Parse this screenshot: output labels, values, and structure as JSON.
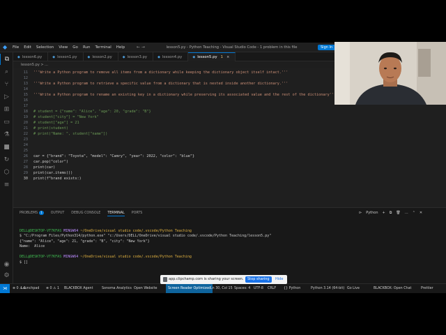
{
  "titlebar": {
    "menu": [
      "File",
      "Edit",
      "Selection",
      "View",
      "Go",
      "Run",
      "Terminal",
      "Help"
    ],
    "window_title": "lesson5.py - Python Teaching - Visual Studio Code - 1 problem in this file",
    "signin_label": "Sign In"
  },
  "tabs": [
    {
      "label": "lesson6.py",
      "active": false
    },
    {
      "label": "lesson1.py",
      "active": false
    },
    {
      "label": "lesson2.py",
      "active": false
    },
    {
      "label": "lesson3.py",
      "active": false
    },
    {
      "label": "lesson4.py",
      "active": false
    },
    {
      "label": "lesson5.py",
      "active": true,
      "modified": "1"
    }
  ],
  "breadcrumb": "lesson5.py > ...",
  "editor": {
    "lines": [
      {
        "n": "11",
        "text": "'''Write a Python program to remove all items from a dictionary while keeping the dictionary object itself intact.'''",
        "kind": "str"
      },
      {
        "n": "12",
        "text": "",
        "kind": "pl"
      },
      {
        "n": "13",
        "text": "'''Write a Python program to retrieve a specific value from a dictionary that is nested inside another dictionary.'''",
        "kind": "str"
      },
      {
        "n": "14",
        "text": "",
        "kind": "pl"
      },
      {
        "n": "15",
        "text": "'''Write a Python program to rename an existing key in a dictionary while preserving its associated value and the rest of the dictionary'''",
        "kind": "str"
      },
      {
        "n": "16",
        "text": "",
        "kind": "pl"
      },
      {
        "n": "17",
        "text": "",
        "kind": "pl"
      },
      {
        "n": "18",
        "text": "# student = {\"name\": \"Alice\", \"age\": 20, \"grade\": \"B\"}",
        "kind": "cmt"
      },
      {
        "n": "19",
        "text": "# student[\"city\"] = \"New York\"",
        "kind": "cmt"
      },
      {
        "n": "20",
        "text": "# student[\"age\"] = 21",
        "kind": "cmt"
      },
      {
        "n": "21",
        "text": "# print(student)",
        "kind": "cmt"
      },
      {
        "n": "22",
        "text": "# print(\"Name: \", student[\"name\"])",
        "kind": "cmt"
      },
      {
        "n": "23",
        "text": "",
        "kind": "pl"
      },
      {
        "n": "24",
        "text": "",
        "kind": "pl"
      },
      {
        "n": "25",
        "text": "",
        "kind": "pl"
      },
      {
        "n": "26",
        "text": "car = {\"brand\": \"Toyota\", \"model\": \"Camry\", \"year\": 2022, \"color\": \"blue\"}",
        "kind": "code"
      },
      {
        "n": "27",
        "text": "car.pop(\"color\")",
        "kind": "code"
      },
      {
        "n": "28",
        "text": "print(car)",
        "kind": "code"
      },
      {
        "n": "29",
        "text": "print(car.items())",
        "kind": "code"
      },
      {
        "n": "30",
        "text": "print(f\"brand exists:)",
        "kind": "code",
        "current": true
      }
    ]
  },
  "panel": {
    "tabs": [
      {
        "label": "PROBLEMS",
        "badge": "1",
        "active": false
      },
      {
        "label": "OUTPUT",
        "active": false
      },
      {
        "label": "DEBUG CONSOLE",
        "active": false
      },
      {
        "label": "TERMINAL",
        "active": true
      },
      {
        "label": "PORTS",
        "active": false
      }
    ],
    "shell_label": "Python",
    "terminal": {
      "prompt_user": "DELL@DESKTOP-VT7KFAS",
      "prompt_sys": "MINGW64",
      "prompt_path": "~/OneDrive/visual studio code/.vscode/Python Teaching",
      "command": "$ \"C:/Program Files/Python314/python.exe\" \"c:/Users/DELL/OneDrive/visual studio code/.vscode/Python Teaching/lesson5.py\"",
      "out1": "{\"name\": \"Alice\", \"age\": 21, \"grade\": \"B\", \"city\": \"New York\"}",
      "out2": "Name:  Alice",
      "prompt2_user": "DELL@DESKTOP-VT7KFAS",
      "prompt2_sys": "MINGW64",
      "prompt2_path": "~/OneDrive/visual studio code/.vscode/Python Teaching",
      "input_line": "$ []"
    }
  },
  "statusbar": {
    "items": [
      {
        "label": "⊗ 0 ⚠ 1",
        "key": "problems"
      },
      {
        "label": "Launchpad",
        "key": "launchpad"
      },
      {
        "label": "⊗ 0 ⚠ 1",
        "key": "problems2"
      },
      {
        "label": "BLACKBOX Agent",
        "key": "bb-agent"
      },
      {
        "label": "Sonoma Analytics",
        "key": "analytics"
      },
      {
        "label": "Open Website",
        "key": "open-website"
      },
      {
        "label": "Screen Reader Optimized",
        "key": "screen-reader",
        "highlight": true
      },
      {
        "label": "Ln 30, Col 15",
        "key": "cursor-pos"
      },
      {
        "label": "Spaces: 4",
        "key": "spaces"
      },
      {
        "label": "UTF-8",
        "key": "encoding"
      },
      {
        "label": "CRLF",
        "key": "eol"
      },
      {
        "label": "{} Python",
        "key": "language"
      },
      {
        "label": "Python 3.14 (64-bit)",
        "key": "interpreter"
      },
      {
        "label": "Go Live",
        "key": "go-live"
      },
      {
        "label": "BLACKBOX: Open Chat",
        "key": "bb-chat"
      },
      {
        "label": "Prettier",
        "key": "prettier"
      }
    ]
  },
  "share_bar": {
    "message": "app.clipchamp.com is sharing your screen.",
    "stop_label": "Stop sharing",
    "hide_label": "Hide"
  }
}
